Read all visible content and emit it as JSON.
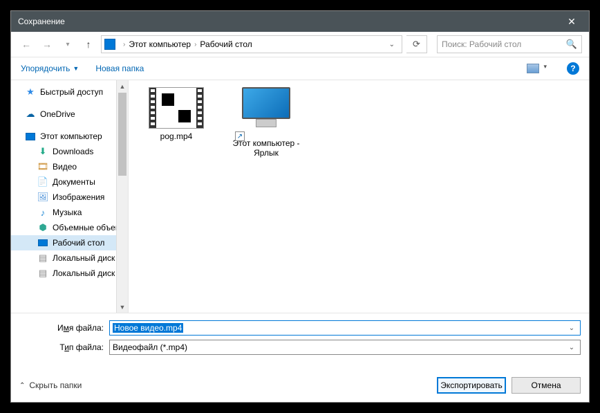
{
  "title": "Сохранение",
  "breadcrumb": {
    "root": "Этот компьютер",
    "current": "Рабочий стол"
  },
  "search": {
    "placeholder": "Поиск: Рабочий стол"
  },
  "toolbar": {
    "organize": "Упорядочить",
    "newfolder": "Новая папка"
  },
  "sidebar": {
    "quick": {
      "label": "Быстрый доступ"
    },
    "onedrive": {
      "label": "OneDrive"
    },
    "thispc": {
      "label": "Этот компьютер"
    },
    "downloads": {
      "label": "Downloads"
    },
    "video": {
      "label": "Видео"
    },
    "docs": {
      "label": "Документы"
    },
    "images": {
      "label": "Изображения"
    },
    "music": {
      "label": "Музыка"
    },
    "volumes": {
      "label": "Объемные объекты"
    },
    "desktop": {
      "label": "Рабочий стол"
    },
    "disk1": {
      "label": "Локальный диск"
    },
    "disk2": {
      "label": "Локальный диск"
    }
  },
  "files": {
    "f1": {
      "name": "pog.mp4"
    },
    "f2": {
      "name": "Этот компьютер - Ярлык"
    }
  },
  "fields": {
    "name_label_pre": "И",
    "name_label_u": "м",
    "name_label_post": "я файла:",
    "type_label_pre": "Т",
    "type_label_u": "и",
    "type_label_post": "п файла:",
    "filename": "Новое видео.mp4",
    "filetype": "Видеофайл (*.mp4)"
  },
  "footer": {
    "hide": "Скрыть папки",
    "export": "Экспортировать",
    "cancel": "Отмена"
  }
}
